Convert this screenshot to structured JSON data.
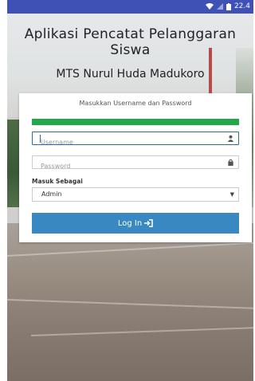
{
  "status_bar": {
    "time": "22.4",
    "icons": [
      "wifi-icon",
      "signal-icon",
      "battery-icon"
    ]
  },
  "header": {
    "title": "Aplikasi Pencatat Pelanggaran Siswa",
    "subtitle": "MTS Nurul Huda Madukoro"
  },
  "login": {
    "heading": "Masukkan Username dan Password",
    "progress_percent": 100,
    "username_placeholder": "Username",
    "password_placeholder": "Password",
    "role_label": "Masuk Sebagai",
    "role_selected": "Admin",
    "submit_label": "Log In"
  },
  "colors": {
    "status_bar": "#3f51b5",
    "progress": "#22a84a",
    "button": "#3a88c1",
    "input_focus": "#2c6aa8"
  }
}
